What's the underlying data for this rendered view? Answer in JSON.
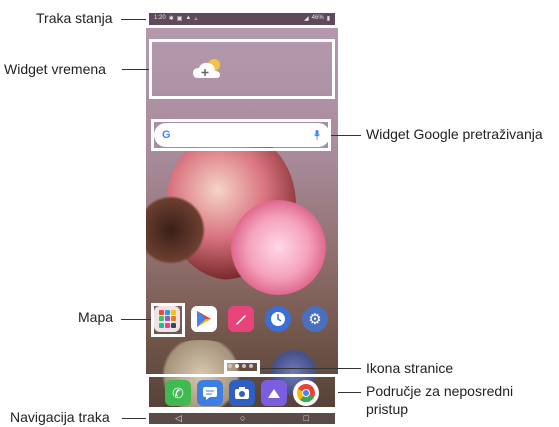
{
  "labels": {
    "status_bar": "Traka stanja",
    "weather_widget": "Widget vremena",
    "google_widget": "Widget Google pretraživanja",
    "folder": "Mapa",
    "page_icon": "Ikona stranice",
    "quick_access_line1": "Područje za neposredni",
    "quick_access_line2": "pristup",
    "nav_bar": "Navigacija traka"
  },
  "status": {
    "time": "1:20",
    "battery": "46%"
  },
  "colors": {
    "highlight": "#ffffff",
    "status_bar_bg": "#5e4a5c",
    "nav_bar_bg": "#5a4b48"
  },
  "apps": [
    "folder-icon",
    "play-store-icon",
    "pen-app-icon",
    "clock-icon",
    "settings-icon"
  ],
  "dock_apps": [
    "phone-icon",
    "messages-icon",
    "camera-icon",
    "gallery-icon",
    "chrome-icon"
  ],
  "nav_buttons": [
    "back-icon",
    "home-icon",
    "recents-icon"
  ]
}
